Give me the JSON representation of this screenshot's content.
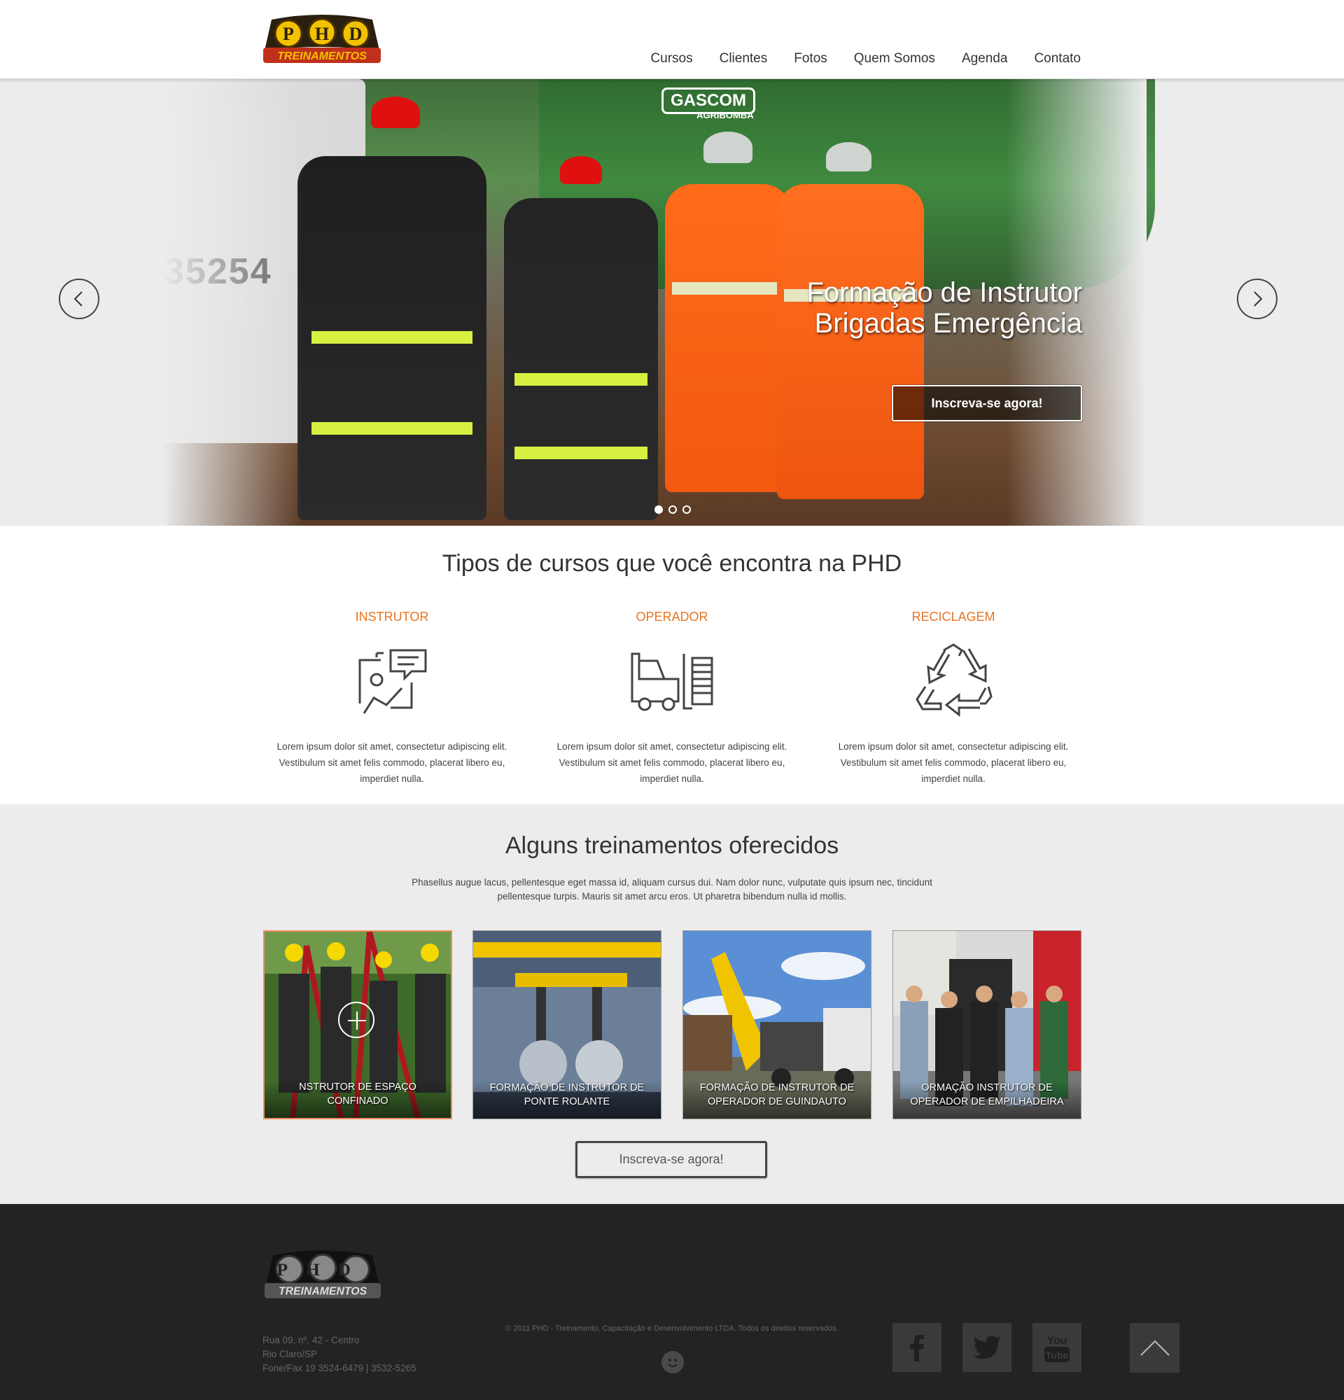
{
  "header": {
    "logo_top": "PHD",
    "logo_bottom": "TREINAMENTOS",
    "nav": [
      "Cursos",
      "Clientes",
      "Fotos",
      "Quem Somos",
      "Agenda",
      "Contato"
    ]
  },
  "hero": {
    "truck_number": "35254",
    "tank_brand": "GASCOM",
    "tank_sub": "AGRIBOMBA",
    "title_line1": "Formação de Instrutor",
    "title_line2": "Brigadas Emergência",
    "cta": "Inscreva-se agora!",
    "slides": 3,
    "active_slide": 1
  },
  "course_types": {
    "title": "Tipos de cursos que você encontra na PHD",
    "items": [
      {
        "title": "INSTRUTOR",
        "icon": "presentation-icon",
        "text": "Lorem ipsum dolor sit amet, consectetur adipiscing elit. Vestibulum sit amet felis commodo, placerat libero eu, imperdiet nulla."
      },
      {
        "title": "OPERADOR",
        "icon": "forklift-icon",
        "text": "Lorem ipsum dolor sit amet, consectetur adipiscing elit. Vestibulum sit amet felis commodo, placerat libero eu, imperdiet nulla."
      },
      {
        "title": "RECICLAGEM",
        "icon": "recycle-icon",
        "text": "Lorem ipsum dolor sit amet, consectetur adipiscing elit. Vestibulum sit amet felis commodo, placerat libero eu, imperdiet nulla."
      }
    ]
  },
  "trainings": {
    "title": "Alguns treinamentos oferecidos",
    "intro": "Phasellus augue lacus, pellentesque eget massa id, aliquam cursus dui. Nam dolor nunc, vulputate quis ipsum nec, tincidunt pellentesque turpis. Mauris sit amet arcu eros. Ut pharetra bibendum nulla id mollis.",
    "cards": [
      {
        "caption": "NSTRUTOR DE ESPAÇO CONFINADO"
      },
      {
        "caption": "FORMAÇÃO DE INSTRUTOR DE PONTE ROLANTE"
      },
      {
        "caption": "FORMAÇÃO DE INSTRUTOR DE OPERADOR DE GUINDAUTO"
      },
      {
        "caption": "ORMAÇÃO INSTRUTOR DE OPERADOR DE EMPILHADEIRA"
      }
    ],
    "cta": "Inscreva-se agora!"
  },
  "footer": {
    "logo_top": "PHD",
    "logo_bottom": "TREINAMENTOS",
    "address": [
      "Rua 09, nº. 42 - Centro",
      "Rio Claro/SP",
      "Fone/Fax 19 3524-6479 | 3532-5265"
    ],
    "copyright": "© 2011 PHD - Treinamento, Capacitação e Desenvolvimento LTDA. Todos os direitos reservados.",
    "social": [
      "facebook-icon",
      "twitter-icon",
      "youtube-icon"
    ],
    "youtube_label_top": "You",
    "youtube_label_bottom": "Tube"
  },
  "colors": {
    "accent": "#e8731f",
    "logo_yellow": "#f2c200",
    "logo_red": "#c0301c",
    "footer_bg": "#232323",
    "section_bg": "#ececec"
  }
}
